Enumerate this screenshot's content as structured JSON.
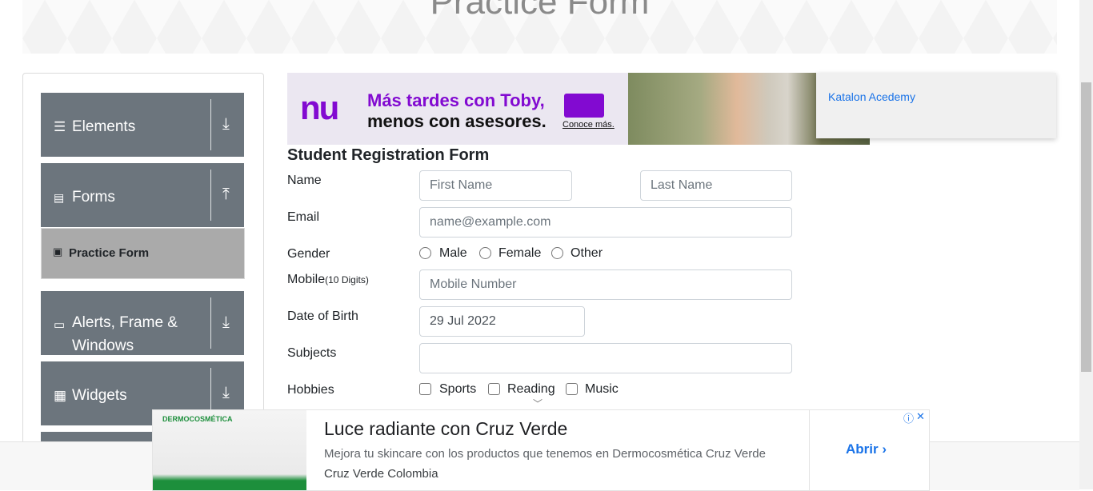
{
  "header": {
    "title": "Practice Form"
  },
  "sidebar": {
    "groups": [
      {
        "label": "Elements",
        "icon": "hamburger-icon",
        "arrow": "⤓"
      },
      {
        "label": "Forms",
        "icon": "document-icon",
        "arrow": "⤒"
      },
      {
        "label": "Alerts, Frame & Windows",
        "icon": "window-icon",
        "arrow": "⤓"
      },
      {
        "label": "Widgets",
        "icon": "widgets-icon",
        "arrow": "⤓"
      }
    ],
    "active_item": {
      "label": "Practice Form",
      "icon": "html-badge-icon"
    }
  },
  "ads": {
    "top": {
      "logo": "nu",
      "line1": "Más tardes con Toby,",
      "line2": "menos con asesores.",
      "cta": "Conoce más."
    },
    "side_link": "Katalon Acedemy",
    "bottom": {
      "brand": "DERMOCOSMÉTICA",
      "title": "Luce radiante con Cruz Verde",
      "description": "Mejora tu skincare con los productos que tenemos en Dermocosmética Cruz Verde",
      "source": "Cruz Verde Colombia",
      "button": "Abrir",
      "info": "ⓘ",
      "close": "✕"
    }
  },
  "form": {
    "title": "Student Registration Form",
    "name": {
      "label": "Name",
      "first_placeholder": "First Name",
      "last_placeholder": "Last Name"
    },
    "email": {
      "label": "Email",
      "placeholder": "name@example.com"
    },
    "gender": {
      "label": "Gender",
      "options": [
        "Male",
        "Female",
        "Other"
      ]
    },
    "mobile": {
      "label": "Mobile",
      "hint": "(10 Digits)",
      "placeholder": "Mobile Number"
    },
    "dob": {
      "label": "Date of Birth",
      "value": "29 Jul 2022"
    },
    "subjects": {
      "label": "Subjects",
      "value": ""
    },
    "hobbies": {
      "label": "Hobbies",
      "options": [
        "Sports",
        "Reading",
        "Music"
      ]
    }
  }
}
